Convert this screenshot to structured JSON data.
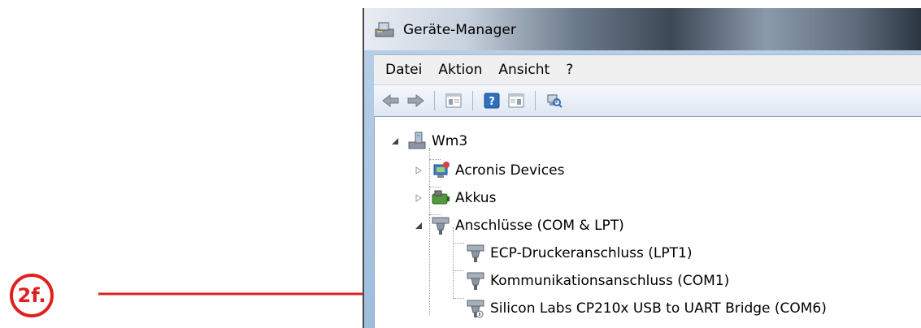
{
  "window": {
    "title": "Geräte-Manager",
    "icon": "device-manager-icon"
  },
  "menu": {
    "items": [
      {
        "label": "Datei"
      },
      {
        "label": "Aktion"
      },
      {
        "label": "Ansicht"
      },
      {
        "label": "?"
      }
    ]
  },
  "toolbar": {
    "buttons": [
      {
        "icon": "back-arrow-icon"
      },
      {
        "icon": "forward-arrow-icon"
      },
      {
        "icon": "console-tree-icon"
      },
      {
        "icon": "help-icon"
      },
      {
        "icon": "properties-pane-icon"
      },
      {
        "icon": "scan-hardware-icon"
      }
    ]
  },
  "tree": {
    "root": {
      "label": "Wm3",
      "expanded": true
    },
    "nodes": [
      {
        "label": "Acronis Devices",
        "expanded": false
      },
      {
        "label": "Akkus",
        "expanded": false
      },
      {
        "label": "Anschlüsse (COM & LPT)",
        "expanded": true,
        "children": [
          {
            "label": "ECP-Druckeranschluss (LPT1)"
          },
          {
            "label": "Kommunikationsanschluss (COM1)"
          },
          {
            "label": "Silicon Labs CP210x USB to UART Bridge (COM6)"
          }
        ]
      }
    ]
  },
  "callout": {
    "label": "2f.",
    "color": "#e02020"
  }
}
